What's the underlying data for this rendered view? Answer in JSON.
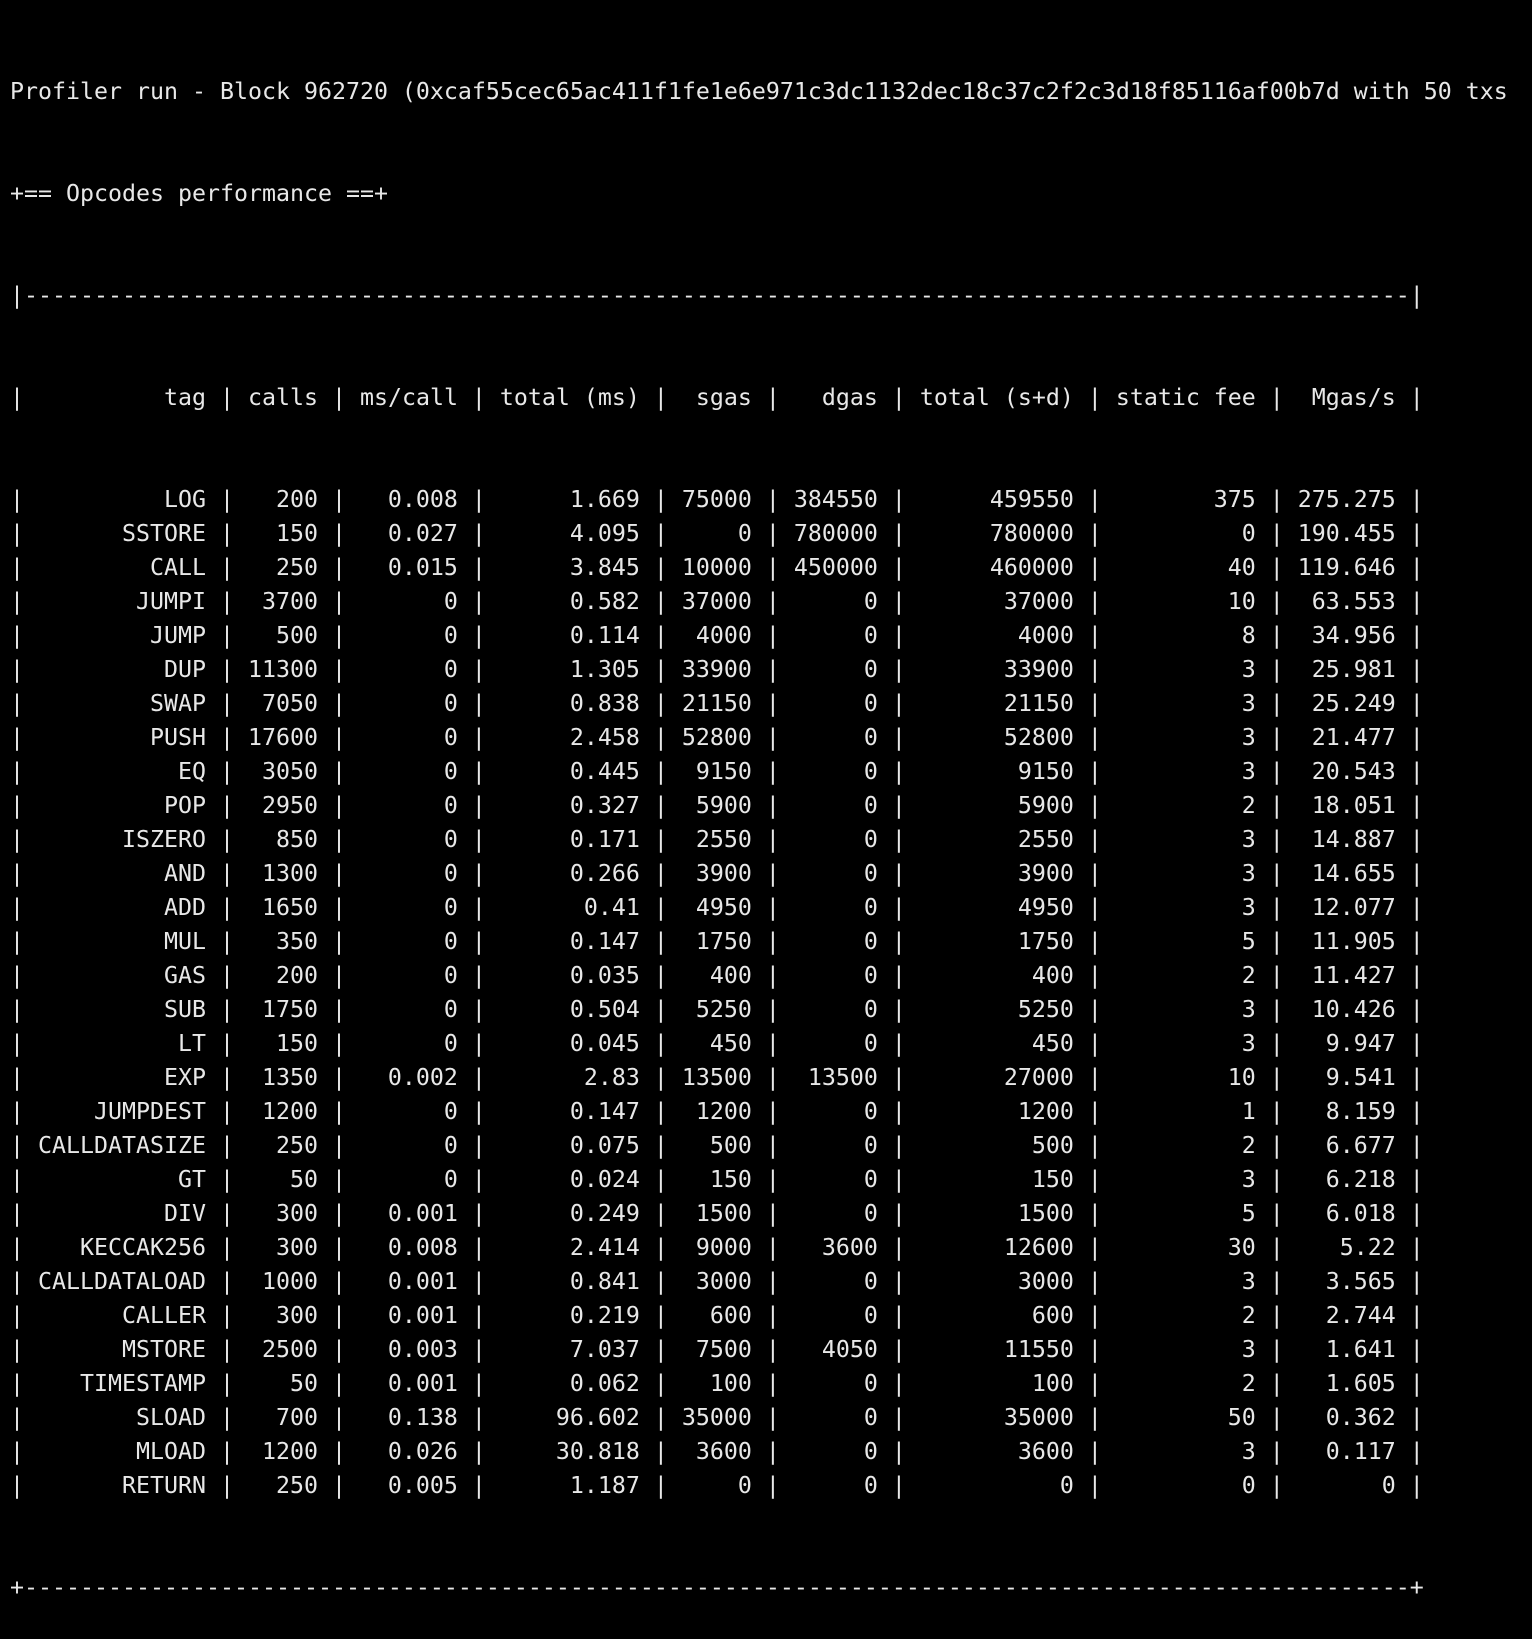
{
  "title_line": "Profiler run - Block 962720 (0xcaf55cec65ac411f1fe1e6e971c3dc1132dec18c37c2f2c3d18f85116af00b7d with 50 txs",
  "section_title": "+== Opcodes performance ==+",
  "table": {
    "columns": [
      "tag",
      "calls",
      "ms/call",
      "total (ms)",
      "sgas",
      "dgas",
      "total (s+d)",
      "static fee",
      "Mgas/s"
    ],
    "rows": [
      [
        "LOG",
        "200",
        "0.008",
        "1.669",
        "75000",
        "384550",
        "459550",
        "375",
        "275.275"
      ],
      [
        "SSTORE",
        "150",
        "0.027",
        "4.095",
        "0",
        "780000",
        "780000",
        "0",
        "190.455"
      ],
      [
        "CALL",
        "250",
        "0.015",
        "3.845",
        "10000",
        "450000",
        "460000",
        "40",
        "119.646"
      ],
      [
        "JUMPI",
        "3700",
        "0",
        "0.582",
        "37000",
        "0",
        "37000",
        "10",
        "63.553"
      ],
      [
        "JUMP",
        "500",
        "0",
        "0.114",
        "4000",
        "0",
        "4000",
        "8",
        "34.956"
      ],
      [
        "DUP",
        "11300",
        "0",
        "1.305",
        "33900",
        "0",
        "33900",
        "3",
        "25.981"
      ],
      [
        "SWAP",
        "7050",
        "0",
        "0.838",
        "21150",
        "0",
        "21150",
        "3",
        "25.249"
      ],
      [
        "PUSH",
        "17600",
        "0",
        "2.458",
        "52800",
        "0",
        "52800",
        "3",
        "21.477"
      ],
      [
        "EQ",
        "3050",
        "0",
        "0.445",
        "9150",
        "0",
        "9150",
        "3",
        "20.543"
      ],
      [
        "POP",
        "2950",
        "0",
        "0.327",
        "5900",
        "0",
        "5900",
        "2",
        "18.051"
      ],
      [
        "ISZERO",
        "850",
        "0",
        "0.171",
        "2550",
        "0",
        "2550",
        "3",
        "14.887"
      ],
      [
        "AND",
        "1300",
        "0",
        "0.266",
        "3900",
        "0",
        "3900",
        "3",
        "14.655"
      ],
      [
        "ADD",
        "1650",
        "0",
        "0.41",
        "4950",
        "0",
        "4950",
        "3",
        "12.077"
      ],
      [
        "MUL",
        "350",
        "0",
        "0.147",
        "1750",
        "0",
        "1750",
        "5",
        "11.905"
      ],
      [
        "GAS",
        "200",
        "0",
        "0.035",
        "400",
        "0",
        "400",
        "2",
        "11.427"
      ],
      [
        "SUB",
        "1750",
        "0",
        "0.504",
        "5250",
        "0",
        "5250",
        "3",
        "10.426"
      ],
      [
        "LT",
        "150",
        "0",
        "0.045",
        "450",
        "0",
        "450",
        "3",
        "9.947"
      ],
      [
        "EXP",
        "1350",
        "0.002",
        "2.83",
        "13500",
        "13500",
        "27000",
        "10",
        "9.541"
      ],
      [
        "JUMPDEST",
        "1200",
        "0",
        "0.147",
        "1200",
        "0",
        "1200",
        "1",
        "8.159"
      ],
      [
        "CALLDATASIZE",
        "250",
        "0",
        "0.075",
        "500",
        "0",
        "500",
        "2",
        "6.677"
      ],
      [
        "GT",
        "50",
        "0",
        "0.024",
        "150",
        "0",
        "150",
        "3",
        "6.218"
      ],
      [
        "DIV",
        "300",
        "0.001",
        "0.249",
        "1500",
        "0",
        "1500",
        "5",
        "6.018"
      ],
      [
        "KECCAK256",
        "300",
        "0.008",
        "2.414",
        "9000",
        "3600",
        "12600",
        "30",
        "5.22"
      ],
      [
        "CALLDATALOAD",
        "1000",
        "0.001",
        "0.841",
        "3000",
        "0",
        "3000",
        "3",
        "3.565"
      ],
      [
        "CALLER",
        "300",
        "0.001",
        "0.219",
        "600",
        "0",
        "600",
        "2",
        "2.744"
      ],
      [
        "MSTORE",
        "2500",
        "0.003",
        "7.037",
        "7500",
        "4050",
        "11550",
        "3",
        "1.641"
      ],
      [
        "TIMESTAMP",
        "50",
        "0.001",
        "0.062",
        "100",
        "0",
        "100",
        "2",
        "1.605"
      ],
      [
        "SLOAD",
        "700",
        "0.138",
        "96.602",
        "35000",
        "0",
        "35000",
        "50",
        "0.362"
      ],
      [
        "MLOAD",
        "1200",
        "0.026",
        "30.818",
        "3600",
        "0",
        "3600",
        "3",
        "0.117"
      ],
      [
        "RETURN",
        "250",
        "0.005",
        "1.187",
        "0",
        "0",
        "0",
        "0",
        "0"
      ]
    ]
  }
}
